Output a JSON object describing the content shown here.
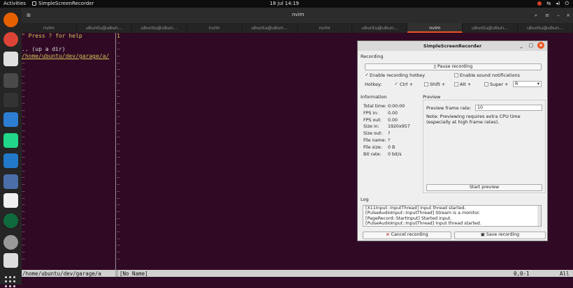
{
  "topbar": {
    "activities": "Activities",
    "app": "SimpleScreenRecorder",
    "clock": "18 jul  14:19"
  },
  "terminal": {
    "title": "nvim",
    "tabs": [
      "nvim",
      "ubuntu@ubun...",
      "ubuntu@ubun...",
      "nvim",
      "ubuntu@ubun...",
      "nvim",
      "ubuntu@ubun...",
      "nvim",
      "ubuntu@ubun...",
      "ubuntu@ubun..."
    ],
    "active_tab": 7
  },
  "vim": {
    "left_lines": [
      "\" Press ? for help",
      "",
      ".. (up a dir)",
      "/home/ubuntu/dev/garage/a/"
    ],
    "right_first": "1",
    "tilde": "~",
    "status_left": "/home/ubuntu/dev/garage/a",
    "status_buffer": "[No Name]",
    "status_pos": "0,0-1",
    "status_all": "All"
  },
  "ssr": {
    "title": "SimpleScreenRecorder",
    "recording_label": "Recording",
    "pause_button": "Pause recording",
    "enable_hotkey": "Enable recording hotkey",
    "enable_sound": "Enable sound notifications",
    "hotkey_label": "Hotkey:",
    "ctrl": "Ctrl +",
    "shift": "Shift +",
    "alt": "Alt +",
    "super": "Super +",
    "key": "R",
    "information_label": "Information",
    "info": [
      {
        "label": "Total time:",
        "value": "0:00:00"
      },
      {
        "label": "FPS in:",
        "value": "0.00"
      },
      {
        "label": "FPS out:",
        "value": "0.00"
      },
      {
        "label": "Size in:",
        "value": "1920x957"
      },
      {
        "label": "Size out:",
        "value": "?"
      },
      {
        "label": "File name:",
        "value": "?"
      },
      {
        "label": "File size:",
        "value": "0 B"
      },
      {
        "label": "Bit rate:",
        "value": "0 bit/s"
      }
    ],
    "preview_label": "Preview",
    "preview_rate_label": "Preview frame rate:",
    "preview_rate": "10",
    "preview_note": "Note: Previewing requires extra CPU time (especially at high frame rates).",
    "start_preview": "Start preview",
    "log_label": "Log",
    "log": [
      "[X11Input::InputThread] Input thread started.",
      "[PulseAudioInput::InputThread] Stream is a monitor.",
      "[PageRecord::StartInput] Started input.",
      "[PulseAudioInput::InputThread] Input thread started."
    ],
    "cancel": "Cancel recording",
    "save": "Save recording"
  }
}
